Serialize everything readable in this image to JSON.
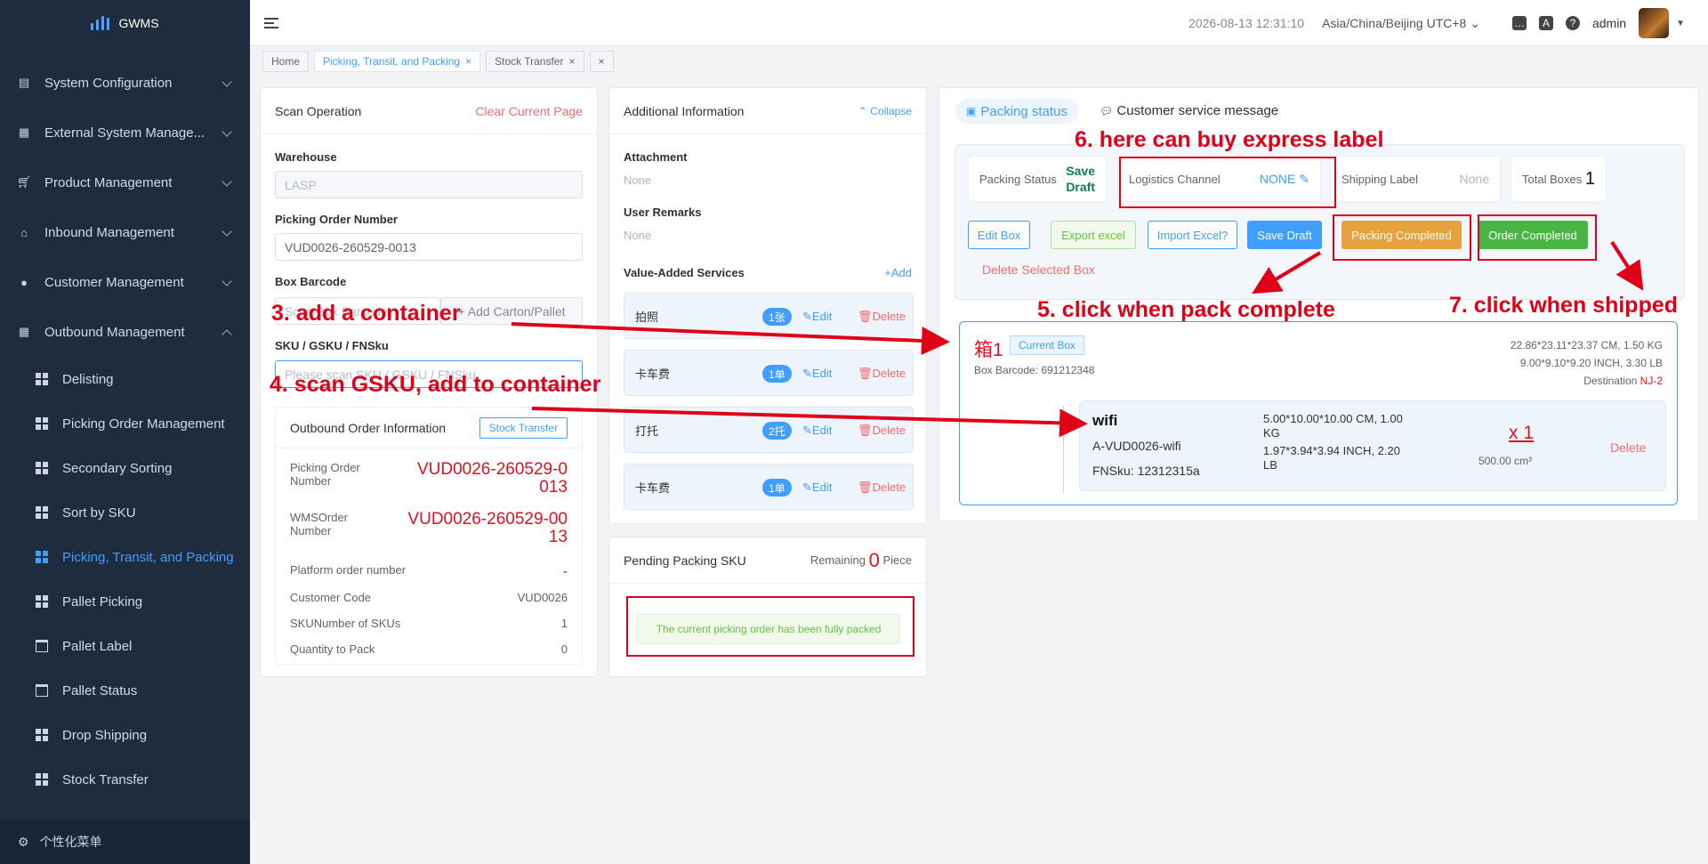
{
  "app": {
    "title": "GWMS"
  },
  "sidebar": {
    "menus": [
      {
        "label": "System Configuration",
        "icon": "document-icon"
      },
      {
        "label": "External System Manage...",
        "icon": "grid-icon"
      },
      {
        "label": "Product Management",
        "icon": "cart-icon"
      },
      {
        "label": "Inbound Management",
        "icon": "home-icon"
      },
      {
        "label": "Customer Management",
        "icon": "user-icon"
      },
      {
        "label": "Outbound Management",
        "icon": "grid-icon"
      }
    ],
    "subitems": [
      "Delisting",
      "Picking Order Management",
      "Secondary Sorting",
      "Sort by SKU",
      "Picking, Transit, and Packing",
      "Pallet Picking",
      "Pallet Label",
      "Pallet Status",
      "Drop Shipping",
      "Stock Transfer"
    ],
    "footer": "个性化菜单"
  },
  "header": {
    "datetime": "2026-08-13 12:31:10",
    "timezone": "Asia/China/Beijing UTC+8",
    "user": "admin"
  },
  "tabs": [
    "Home",
    "Picking, Transit, and Packing",
    "Stock Transfer"
  ],
  "scan": {
    "title": "Scan Operation",
    "clear": "Clear Current Page",
    "warehouse_label": "Warehouse",
    "warehouse_value": "LASP",
    "order_label": "Picking Order Number",
    "order_value": "VUD0026-260529-0013",
    "box_label": "Box Barcode",
    "box_placeholder": "Scan Box Barcode",
    "add_carton": "+ Add Carton/Pallet",
    "sku_label": "SKU / GSKU / FNSku",
    "sku_placeholder": "Please scan SKU / GSKU / FNSku"
  },
  "outbound": {
    "title": "Outbound Order Information",
    "stock_btn": "Stock Transfer",
    "picking_label_1": "Picking Order",
    "picking_label_2": "Number",
    "picking_value_1": "VUD0026-260529-0",
    "picking_value_2": "013",
    "wms_label_1": "WMSOrder",
    "wms_label_2": "Number",
    "wms_value_1": "VUD0026-260529-00",
    "wms_value_2": "13",
    "platform_label": "Platform order number",
    "platform_value": "-",
    "customer_label": "Customer Code",
    "customer_value": "VUD0026",
    "skus_label": "SKUNumber of SKUs",
    "skus_value": "1",
    "qty_label": "Quantity to Pack",
    "qty_value": "0"
  },
  "additional": {
    "title": "Additional Information",
    "collapse": "Collapse",
    "attachment_label": "Attachment",
    "attachment_value": "None",
    "remarks_label": "User Remarks",
    "remarks_value": "None",
    "vas_label": "Value-Added Services",
    "add": "+Add",
    "edit": "Edit",
    "delete": "Delete",
    "services": [
      {
        "name": "拍照",
        "count": "1张"
      },
      {
        "name": "卡车费",
        "count": "1单"
      },
      {
        "name": "打托",
        "count": "2托"
      },
      {
        "name": "卡车费",
        "count": "1单"
      }
    ]
  },
  "pending": {
    "title": "Pending Packing SKU",
    "remaining": "Remaining",
    "count": "0",
    "unit": "Piece",
    "message": "The current picking order has been fully packed"
  },
  "packing": {
    "tab_status": "Packing status",
    "tab_message": "Customer service message",
    "status_label": "Packing Status",
    "status_value_1": "Save",
    "status_value_2": "Draft",
    "logistics_label": "Logistics Channel",
    "logistics_value": "NONE",
    "shipping_label": "Shipping Label",
    "shipping_value": "None",
    "boxes_label": "Total Boxes",
    "boxes_value": "1",
    "buttons": {
      "edit_box": "Edit Box",
      "export": "Export excel",
      "import": "Import Excel?",
      "save_draft": "Save Draft",
      "packing_completed": "Packing Completed",
      "order_completed": "Order Completed",
      "delete_selected": "Delete Selected Box"
    },
    "box": {
      "name": "箱1",
      "badge": "Current Box",
      "barcode": "Box Barcode: 691212348",
      "dim_cm": "22.86*23.11*23.37 CM, 1.50 KG",
      "dim_inch": "9.00*9.10*9.20 INCH, 3.30 LB",
      "dest_label": "Destination",
      "dest_value": "NJ-2"
    },
    "item": {
      "name": "wifi",
      "code": "A-VUD0026-wifi",
      "fnsku": "FNSku: 12312315a",
      "dim_cm_1": "5.00*10.00*10.00 CM, 1.00",
      "dim_cm_2": "KG",
      "dim_inch_1": "1.97*3.94*3.94 INCH, 2.20",
      "dim_inch_2": "LB",
      "qty": "x 1",
      "volume": "500.00 cm³",
      "delete": "Delete"
    }
  },
  "annotations": {
    "a3": "3. add a container",
    "a4": "4. scan GSKU, add to container",
    "a5": "5. click when pack complete",
    "a6": "6. here can buy express label",
    "a7": "7. click when shipped"
  },
  "colors": {
    "sidebar": "#1e2c3e",
    "accent": "#409eff",
    "annotation": "#e00018",
    "success": "#67c23a",
    "warning": "#e6a23c"
  }
}
